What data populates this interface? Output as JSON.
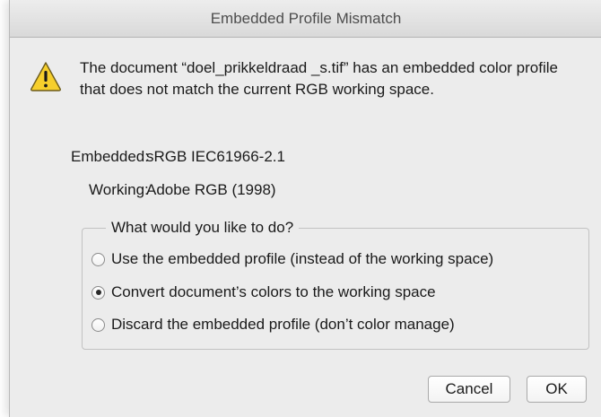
{
  "dialog": {
    "title": "Embedded Profile Mismatch",
    "message": "The document “doel_prikkeldraad _s.tif” has an embedded color profile that does not match the current RGB working space.",
    "embedded_label": "Embedded:",
    "embedded_value": "sRGB IEC61966-2.1",
    "working_label": "Working:",
    "working_value": "Adobe RGB (1998)",
    "icon": "warning-icon"
  },
  "options": {
    "legend": "What would you like to do?",
    "items": [
      {
        "label": "Use the embedded profile (instead of the working space)",
        "selected": false
      },
      {
        "label": "Convert document’s colors to the working space",
        "selected": true
      },
      {
        "label": "Discard the embedded profile (don’t color manage)",
        "selected": false
      }
    ]
  },
  "buttons": {
    "cancel_label": "Cancel",
    "ok_label": "OK"
  },
  "colors": {
    "dialog_background": "#ececec",
    "warning_yellow": "#f6cf2c"
  }
}
